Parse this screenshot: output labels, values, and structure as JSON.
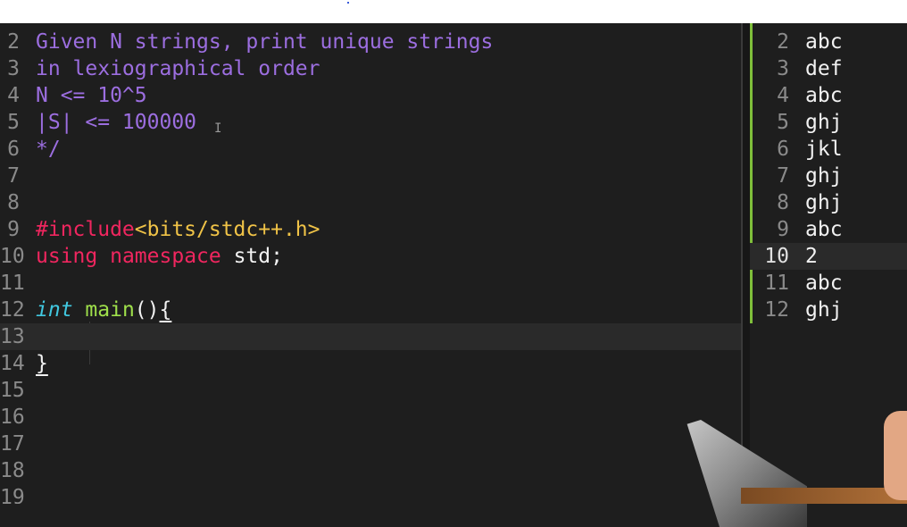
{
  "editor": {
    "lines": [
      {
        "num": "2",
        "tokens": [
          {
            "t": "Given N strings, print unique strings",
            "c": "comment"
          }
        ]
      },
      {
        "num": "3",
        "tokens": [
          {
            "t": "in lexiographical order",
            "c": "comment"
          }
        ]
      },
      {
        "num": "4",
        "tokens": [
          {
            "t": "N <= 10^5",
            "c": "comment"
          }
        ]
      },
      {
        "num": "5",
        "tokens": [
          {
            "t": "|S| <= 100000",
            "c": "comment"
          }
        ]
      },
      {
        "num": "6",
        "tokens": [
          {
            "t": "*/",
            "c": "comment"
          }
        ]
      },
      {
        "num": "7",
        "tokens": []
      },
      {
        "num": "8",
        "tokens": []
      },
      {
        "num": "9",
        "tokens": [
          {
            "t": "#include",
            "c": "kw"
          },
          {
            "t": "<bits/stdc++.h>",
            "c": "include"
          }
        ]
      },
      {
        "num": "10",
        "tokens": [
          {
            "t": "using",
            "c": "kw"
          },
          {
            "t": " ",
            "c": "plain"
          },
          {
            "t": "namespace",
            "c": "kw"
          },
          {
            "t": " std;",
            "c": "plain"
          }
        ]
      },
      {
        "num": "11",
        "tokens": []
      },
      {
        "num": "12",
        "tokens": [
          {
            "t": "int",
            "c": "type"
          },
          {
            "t": " ",
            "c": "plain"
          },
          {
            "t": "main",
            "c": "fn"
          },
          {
            "t": "()",
            "c": "plain"
          },
          {
            "t": "{",
            "c": "brace"
          }
        ]
      },
      {
        "num": "13",
        "tokens": [],
        "current": true
      },
      {
        "num": "14",
        "tokens": [
          {
            "t": "}",
            "c": "brace"
          }
        ]
      },
      {
        "num": "15",
        "tokens": []
      },
      {
        "num": "16",
        "tokens": []
      },
      {
        "num": "17",
        "tokens": []
      },
      {
        "num": "18",
        "tokens": []
      },
      {
        "num": "19",
        "tokens": []
      }
    ],
    "caret_glyph": "I"
  },
  "input_panel": {
    "lines": [
      {
        "num": "2",
        "text": "abc"
      },
      {
        "num": "3",
        "text": "def"
      },
      {
        "num": "4",
        "text": "abc"
      },
      {
        "num": "5",
        "text": "ghj"
      },
      {
        "num": "6",
        "text": "jkl"
      },
      {
        "num": "7",
        "text": "ghj"
      },
      {
        "num": "8",
        "text": "ghj"
      },
      {
        "num": "9",
        "text": "abc"
      },
      {
        "num": "10",
        "text": "2",
        "current": true
      },
      {
        "num": "11",
        "text": "abc"
      },
      {
        "num": "12",
        "text": "ghj"
      }
    ]
  },
  "colors": {
    "background": "#1e1e1e",
    "comment": "#9c6ee0",
    "keyword": "#f0265f",
    "include": "#f0c347",
    "type": "#41c8e0",
    "function": "#9fe04b",
    "gutter_bar": "#7fbf3a"
  }
}
